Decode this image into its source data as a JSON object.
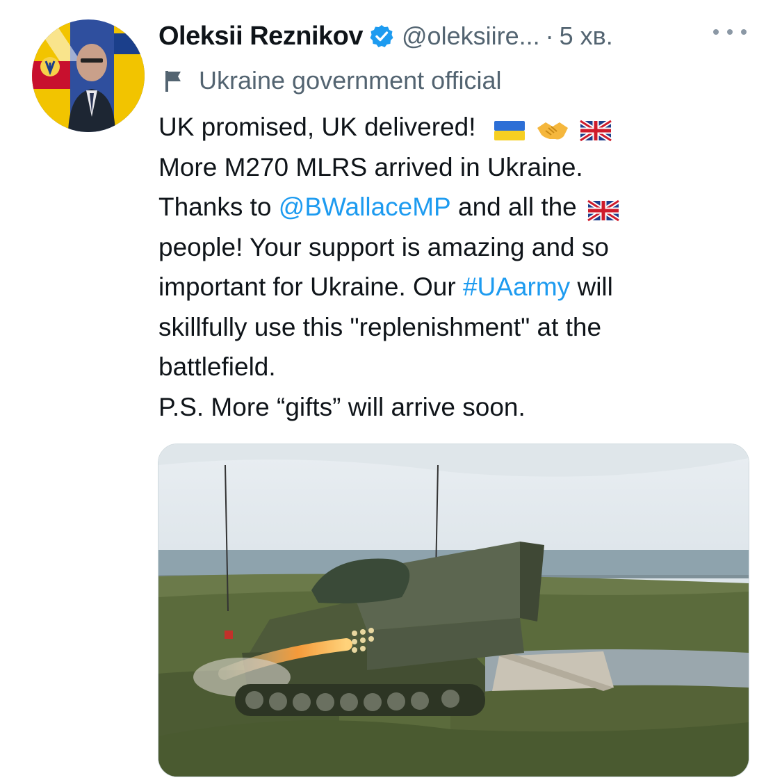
{
  "tweet": {
    "author_name": "Oleksii Reznikov",
    "handle": "@oleksiire...",
    "separator": "·",
    "time": "5 хв.",
    "account_label": "Ukraine government official",
    "lines": [
      {
        "parts": [
          {
            "text": "UK promised, UK delivered! ",
            "type": "text"
          }
        ],
        "emojis": [
          "ukraine-flag-icon",
          "handshake-icon",
          "uk-flag-icon"
        ]
      },
      {
        "parts": [
          {
            "text": "More M270 MLRS arrived in Ukraine.",
            "type": "text"
          }
        ],
        "emojis": []
      },
      {
        "parts": [
          {
            "text": "Thanks to ",
            "type": "text"
          },
          {
            "text": "@BWallaceMP",
            "type": "link"
          },
          {
            "text": " and all the",
            "type": "text"
          }
        ],
        "emojis": [
          "uk-flag-icon"
        ]
      },
      {
        "parts": [
          {
            "text": "people! Your support is amazing and so",
            "type": "text"
          }
        ],
        "emojis": []
      },
      {
        "parts": [
          {
            "text": "important for Ukraine. Our ",
            "type": "text"
          },
          {
            "text": "#UAarmy",
            "type": "link"
          },
          {
            "text": " will",
            "type": "text"
          }
        ],
        "emojis": []
      },
      {
        "parts": [
          {
            "text": "skillfully use this \"replenishment\" at the",
            "type": "text"
          }
        ],
        "emojis": []
      },
      {
        "parts": [
          {
            "text": "battlefield.",
            "type": "text"
          }
        ],
        "emojis": []
      },
      {
        "parts": [
          {
            "text": "P.S. More “gifts” will arrive soon.",
            "type": "text"
          }
        ],
        "emojis": []
      }
    ],
    "colors": {
      "link": "#1d9bf0",
      "muted": "#536471",
      "verified": "#1d9bf0"
    },
    "icons": {
      "verified": "verified-badge-icon",
      "label": "flag-icon",
      "more": "more-dots-icon"
    },
    "media_alt_subject": "M270 MLRS launcher firing on grassy coast"
  }
}
